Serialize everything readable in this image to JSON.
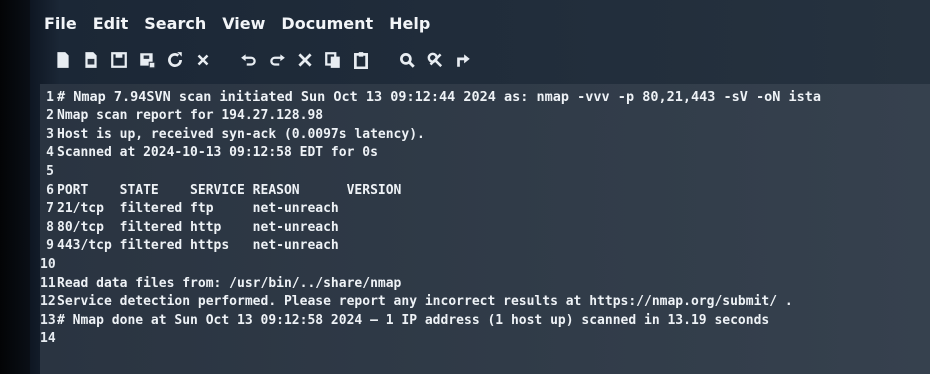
{
  "menu": [
    "File",
    "Edit",
    "Search",
    "View",
    "Document",
    "Help"
  ],
  "toolbar": [
    {
      "name": "new-file-icon"
    },
    {
      "name": "open-file-icon"
    },
    {
      "name": "save-icon"
    },
    {
      "name": "save-as-icon"
    },
    {
      "name": "reload-icon"
    },
    {
      "name": "close-icon"
    },
    {
      "sep": true
    },
    {
      "name": "undo-icon"
    },
    {
      "name": "redo-icon"
    },
    {
      "name": "cut-icon"
    },
    {
      "name": "copy-icon"
    },
    {
      "name": "paste-icon"
    },
    {
      "sep": true
    },
    {
      "name": "search-icon"
    },
    {
      "name": "replace-icon"
    },
    {
      "name": "goto-icon"
    }
  ],
  "lines": [
    {
      "n": "1",
      "text": "# Nmap 7.94SVN scan initiated Sun Oct 13 09:12:44 2024 as: nmap -vvv -p 80,21,443 -sV -oN ista"
    },
    {
      "n": "2",
      "text": "Nmap scan report for 194.27.128.98"
    },
    {
      "n": "3",
      "text": "Host is up, received syn-ack (0.0097s latency)."
    },
    {
      "n": "4",
      "text": "Scanned at 2024-10-13 09:12:58 EDT for 0s"
    },
    {
      "n": "5",
      "text": ""
    },
    {
      "n": "6",
      "text": "PORT    STATE    SERVICE REASON      VERSION"
    },
    {
      "n": "7",
      "text": "21/tcp  filtered ftp     net-unreach"
    },
    {
      "n": "8",
      "text": "80/tcp  filtered http    net-unreach"
    },
    {
      "n": "9",
      "text": "443/tcp filtered https   net-unreach"
    },
    {
      "n": "10",
      "text": ""
    },
    {
      "n": "11",
      "text": "Read data files from: /usr/bin/../share/nmap"
    },
    {
      "n": "12",
      "text": "Service detection performed. Please report any incorrect results at https://nmap.org/submit/ ."
    },
    {
      "n": "13",
      "text": "# Nmap done at Sun Oct 13 09:12:58 2024 — 1 IP address (1 host up) scanned in 13.19 seconds"
    },
    {
      "n": "14",
      "text": ""
    }
  ]
}
